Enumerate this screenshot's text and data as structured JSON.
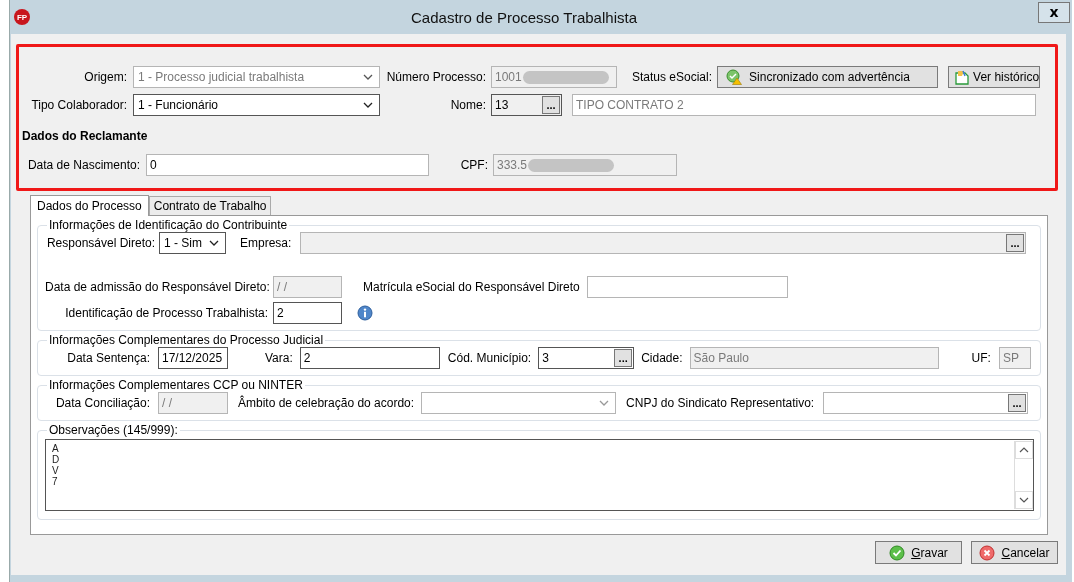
{
  "window": {
    "logo": "FP",
    "title": "Cadastro de Processo Trabalhista",
    "close": "x"
  },
  "header": {
    "origem": {
      "label": "Origem:",
      "value": "1 - Processo judicial trabalhista",
      "disabled": true
    },
    "numero_processo": {
      "label": "Número Processo:",
      "value": "1001",
      "disabled": true,
      "redacted": true
    },
    "status_esocial": {
      "label": "Status eSocial:",
      "value": "Sincronizado com advertência"
    },
    "ver_historico": "Ver histórico",
    "tipo_colaborador": {
      "label": "Tipo Colaborador:",
      "value": "1 - Funcionário",
      "disabled": false
    },
    "nome": {
      "label": "Nome:",
      "code": "13",
      "lookup": "...",
      "name": "TIPO CONTRATO 2"
    },
    "section_title": "Dados do Reclamante",
    "data_nascimento": {
      "label": "Data de Nascimento:",
      "value": "0",
      "disabled": false
    },
    "cpf": {
      "label": "CPF:",
      "value": "333.5",
      "disabled": true,
      "redacted": true
    }
  },
  "tabs": [
    {
      "label": "Dados do Processo",
      "selected": true
    },
    {
      "label": "Contrato de Trabalho",
      "selected": false
    }
  ],
  "identificacao": {
    "title": "Informações de Identificação do Contribuinte",
    "responsavel_direto": {
      "label": "Responsável Direto:",
      "value": "1 - Sim"
    },
    "empresa": {
      "label": "Empresa:",
      "disabled": true,
      "lookup": "..."
    },
    "data_admissao": {
      "label": "Data de admissão do Responsável Direto:",
      "value": "/ /",
      "disabled": true
    },
    "matricula": {
      "label": "Matrícula eSocial do Responsável Direto"
    },
    "identificacao_processo": {
      "label": "Identificação de Processo Trabalhista:",
      "value": "2"
    }
  },
  "processo_judicial": {
    "title": "Informações Complementares do Processo Judicial",
    "data_sentenca": {
      "label": "Data Sentença:",
      "value": "17/12/2025"
    },
    "vara": {
      "label": "Vara:",
      "value": "2"
    },
    "cod_municipio": {
      "label": "Cód. Município:",
      "value": "3",
      "lookup": "..."
    },
    "cidade": {
      "label": "Cidade:",
      "value": "São Paulo",
      "disabled": true
    },
    "uf": {
      "label": "UF:",
      "value": "SP",
      "disabled": true
    }
  },
  "ccp_ninter": {
    "title": "Informações Complementares CCP ou NINTER",
    "data_conciliacao": {
      "label": "Data Conciliação:",
      "value": "/ /",
      "disabled": true
    },
    "ambito": {
      "label": "Âmbito de celebração do acordo:",
      "disabled": true
    },
    "cnpj_sindicato": {
      "label": "CNPJ do Sindicato Representativo:",
      "lookup": "..."
    }
  },
  "observacoes": {
    "title": "Observações (145/999):",
    "lines": [
      "A",
      "D",
      "V",
      "7"
    ]
  },
  "buttons": [
    {
      "kind": "save",
      "label": "Gravar"
    },
    {
      "kind": "cancel",
      "label": "Cancelar"
    }
  ]
}
